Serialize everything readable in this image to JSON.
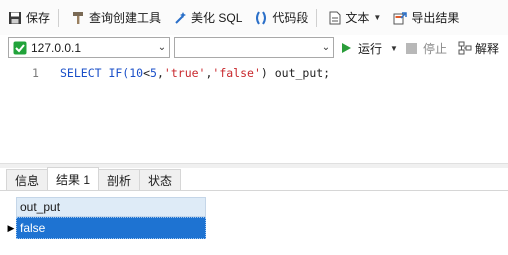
{
  "toolbar": {
    "save_label": "保存",
    "query_builder_label": "查询创建工具",
    "beautify_sql_label": "美化 SQL",
    "code_snippet_label": "代码段",
    "text_label": "文本",
    "export_results_label": "导出结果"
  },
  "connection": {
    "selected": "127.0.0.1",
    "database_selected": ""
  },
  "actions": {
    "run_label": "运行",
    "stop_label": "停止",
    "explain_label": "解释"
  },
  "editor": {
    "line_number": "1",
    "code": {
      "t1": "SELECT IF(",
      "t2": "10",
      "t3": "<",
      "t4": "5",
      "t5": ",",
      "t6": "'true'",
      "t7": ",",
      "t8": "'false'",
      "t9": ") out_put;"
    }
  },
  "tabs": [
    {
      "label": "信息"
    },
    {
      "label": "结果 1"
    },
    {
      "label": "剖析"
    },
    {
      "label": "状态"
    }
  ],
  "results": {
    "columns": [
      "out_put"
    ],
    "rows": [
      [
        "false"
      ]
    ],
    "current_row_marker": "▶"
  },
  "colors": {
    "accent": "#1e73d2",
    "header_bg": "#deebf7",
    "keyword": "#1a4fc8",
    "string": "#c8282d",
    "run_green": "#2a9d3a",
    "connection_green": "#21a33a"
  }
}
